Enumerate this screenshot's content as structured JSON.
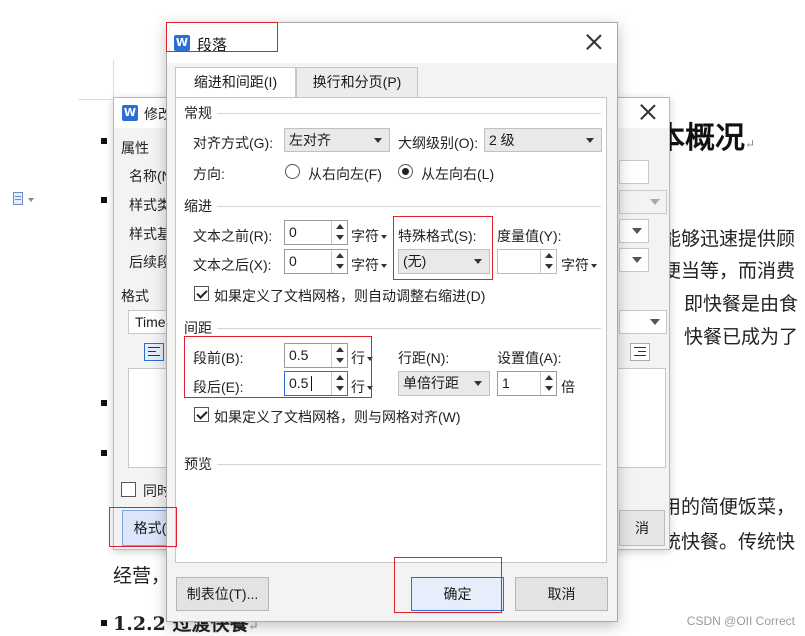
{
  "document": {
    "heading_fragment": "本概况",
    "lines": [
      "能够迅速提供顾",
      "便当等，而消费",
      "即快餐是由食",
      "快餐已成为了",
      "用的简便饭菜，",
      "统快餐。传统快",
      "经营，"
    ],
    "subheading": "1.2.2 过渡快餐"
  },
  "bg_dialog": {
    "title": "修改",
    "properties_label": "属性",
    "name_label": "名称(N",
    "style_type_label": "样式类",
    "style_base_label": "样式基",
    "following_label": "后续段",
    "format_label": "格式",
    "font_value": "Time",
    "also_label": "同时",
    "format_button": "格式(",
    "cancel_button_fragment": "消"
  },
  "dialog": {
    "title": "段落",
    "close_label": "关闭",
    "tabs": [
      {
        "label": "缩进和间距(I)",
        "active": true
      },
      {
        "label": "换行和分页(P)",
        "active": false
      }
    ],
    "general": {
      "section": "常规",
      "alignment_label": "对齐方式(G):",
      "alignment_value": "左对齐",
      "outline_label": "大纲级别(O):",
      "outline_value": "2 级",
      "direction_label": "方向:",
      "rtl_label": "从右向左(F)",
      "ltr_label": "从左向右(L)",
      "direction_selected": "ltr"
    },
    "indent": {
      "section": "缩进",
      "before_label": "文本之前(R):",
      "before_value": "0",
      "before_unit": "字符",
      "after_label": "文本之后(X):",
      "after_value": "0",
      "after_unit": "字符",
      "special_label": "特殊格式(S):",
      "special_value": "(无)",
      "measure_label": "度量值(Y):",
      "measure_value": "",
      "measure_unit": "字符",
      "auto_adjust_label": "如果定义了文档网格，则自动调整右缩进(D)",
      "auto_adjust_checked": true
    },
    "spacing": {
      "section": "间距",
      "before_label": "段前(B):",
      "before_value": "0.5",
      "before_unit": "行",
      "after_label": "段后(E):",
      "after_value": "0.5",
      "after_unit": "行",
      "line_spacing_label": "行距(N):",
      "line_spacing_value": "单倍行距",
      "set_value_label": "设置值(A):",
      "set_value": "1",
      "set_value_unit": "倍",
      "snap_grid_label": "如果定义了文档网格，则与网格对齐(W)",
      "snap_grid_checked": true
    },
    "preview": {
      "section": "预览"
    },
    "buttons": {
      "tabs": "制表位(T)...",
      "ok": "确定",
      "cancel": "取消"
    }
  },
  "watermark": "CSDN @OII Correct",
  "colors": {
    "accent": "#2b6fd6",
    "highlight": "#e0202a"
  }
}
